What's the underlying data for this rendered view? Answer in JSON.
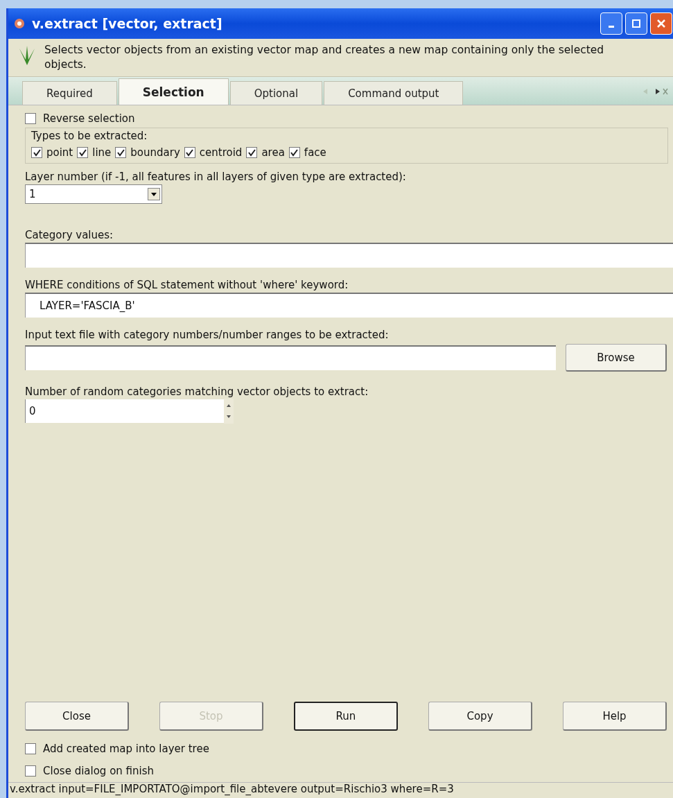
{
  "window": {
    "title": "v.extract [vector, extract]"
  },
  "description": "Selects vector objects from an existing vector map and creates a new map containing only the selected objects.",
  "tabs": [
    {
      "label": "Required",
      "selected": false
    },
    {
      "label": "Selection",
      "selected": true
    },
    {
      "label": "Optional",
      "selected": false
    },
    {
      "label": "Command output",
      "selected": false
    }
  ],
  "reverse_selection": {
    "label": "Reverse selection",
    "checked": false
  },
  "types": {
    "title": "Types to be extracted:",
    "items": [
      {
        "label": "point",
        "checked": true
      },
      {
        "label": "line",
        "checked": true
      },
      {
        "label": "boundary",
        "checked": true
      },
      {
        "label": "centroid",
        "checked": true
      },
      {
        "label": "area",
        "checked": true
      },
      {
        "label": "face",
        "checked": true
      }
    ]
  },
  "layer": {
    "label": "Layer number (if -1, all features in all layers of given type are  extracted):",
    "value": "1"
  },
  "category": {
    "label": "Category values:"
  },
  "where": {
    "label": "WHERE conditions of SQL statement without 'where' keyword:",
    "value": "LAYER='FASCIA_B'"
  },
  "file": {
    "label": "Input text file with category numbers/number ranges to be extracted:",
    "button": "Browse"
  },
  "random": {
    "label": "Number of random categories matching vector objects to extract:",
    "value": "0"
  },
  "buttons": [
    {
      "label": "Close",
      "disabled": false,
      "default": false
    },
    {
      "label": "Stop",
      "disabled": true,
      "default": false
    },
    {
      "label": "Run",
      "disabled": false,
      "default": true
    },
    {
      "label": "Copy",
      "disabled": false,
      "default": false
    },
    {
      "label": "Help",
      "disabled": false,
      "default": false
    }
  ],
  "options": [
    {
      "label": "Add created map into layer tree",
      "checked": false
    },
    {
      "label": "Close dialog on finish",
      "checked": false
    }
  ],
  "status_bar": "v.extract input=FILE_IMPORTATO@import_file_abtevere output=Rischio3 where=R=3"
}
